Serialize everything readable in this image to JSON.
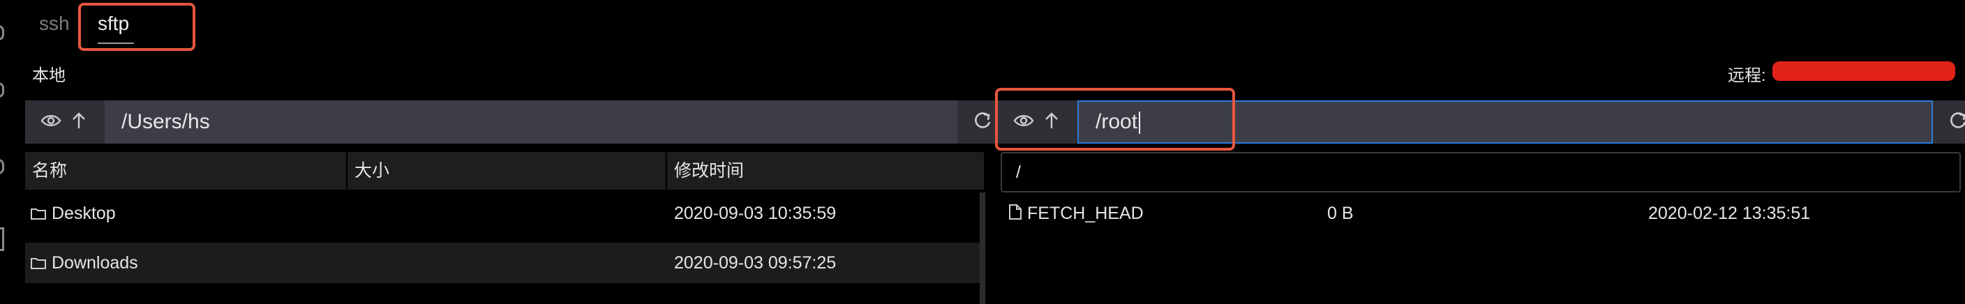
{
  "tabs": [
    {
      "label": "ssh",
      "active": false
    },
    {
      "label": "sftp",
      "active": true
    }
  ],
  "local": {
    "label": "本地",
    "path": "/Users/hs",
    "columns": [
      "名称",
      "大小",
      "修改时间"
    ],
    "files": [
      {
        "name": "Desktop",
        "size": "",
        "modified": "2020-09-03 10:35:59",
        "type": "folder"
      },
      {
        "name": "Downloads",
        "size": "",
        "modified": "2020-09-03 09:57:25",
        "type": "folder"
      }
    ]
  },
  "remote": {
    "label": "远程:",
    "path": "/root",
    "current_dir": "/",
    "files": [
      {
        "name": "FETCH_HEAD",
        "size": "0 B",
        "modified": "2020-02-12 13:35:51",
        "type": "file"
      }
    ]
  },
  "icons": {
    "toggle_hidden": "eye-icon",
    "go_up": "arrow-up-icon",
    "refresh": "refresh-icon",
    "folder": "folder-icon",
    "file": "file-icon"
  },
  "colors": {
    "background": "#000000",
    "highlight": "#e8553d",
    "focus": "#2e7bd9",
    "redaction": "#e2231a"
  }
}
